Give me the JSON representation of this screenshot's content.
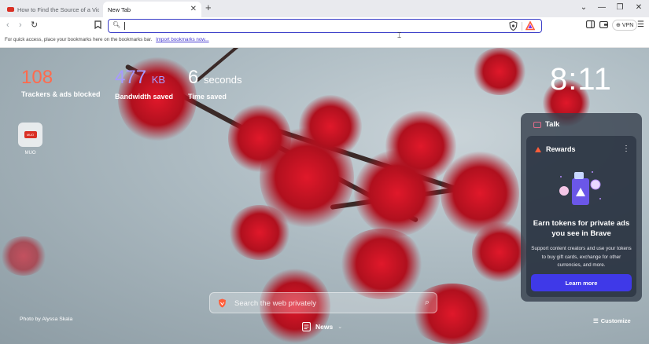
{
  "tabs": [
    {
      "title": "How to Find the Source of a Video",
      "active": false
    },
    {
      "title": "New Tab",
      "active": true
    }
  ],
  "toolbar": {
    "vpn_label": "VPN",
    "url_value": ""
  },
  "bookmarks_bar": {
    "message": "For quick access, place your bookmarks here on the bookmarks bar.",
    "import_link": "Import bookmarks now..."
  },
  "stats": [
    {
      "value": "108",
      "unit": "",
      "label": "Trackers & ads blocked",
      "color": "#ff6a4d"
    },
    {
      "value": "477",
      "unit": "KB",
      "label": "Bandwidth saved",
      "color": "#a79aff"
    },
    {
      "value": "6",
      "unit": "seconds",
      "label": "Time saved",
      "color": "#ffffff"
    }
  ],
  "clock": "8:11",
  "shortcut": {
    "label": "MUO",
    "icon_text": "MUO"
  },
  "widget": {
    "talk_label": "Talk",
    "rewards": {
      "title": "Rewards",
      "heading": "Earn tokens for private ads you see in Brave",
      "body": "Support content creators and use your tokens to buy gift cards, exchange for other currencies, and more.",
      "button": "Learn more"
    }
  },
  "search": {
    "placeholder": "Search the web privately"
  },
  "photo_credit": "Photo by Alyssa Skala",
  "news_label": "News",
  "customize_label": "Customize",
  "colors": {
    "accent": "#3f39e8",
    "brave_orange": "#ff5d3a",
    "url_focus": "#3b3ec8"
  }
}
